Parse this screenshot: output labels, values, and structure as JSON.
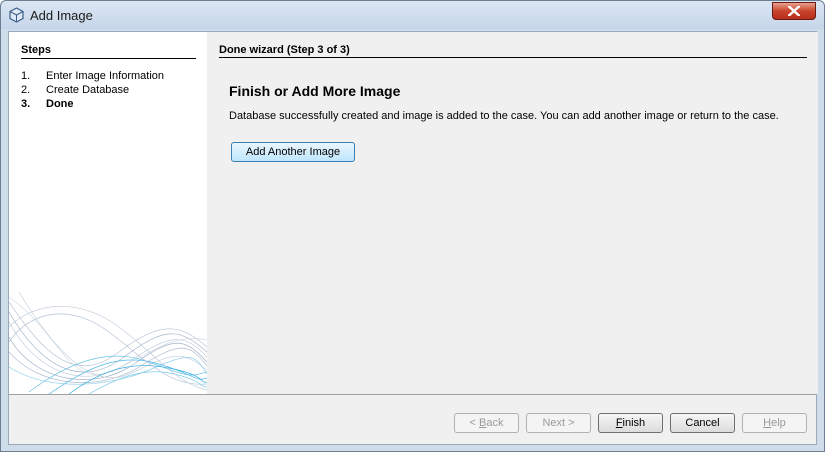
{
  "window": {
    "title": "Add Image"
  },
  "steps": {
    "title": "Steps",
    "items": [
      {
        "num": "1.",
        "label": "Enter Image Information"
      },
      {
        "num": "2.",
        "label": "Create Database"
      },
      {
        "num": "3.",
        "label": "Done"
      }
    ],
    "current_index": 2
  },
  "content": {
    "header": "Done wizard (Step 3 of 3)",
    "heading": "Finish or Add More Image",
    "message": "Database successfully created and image is added to the case. You can add another image or return to the case.",
    "add_button": "Add Another Image"
  },
  "buttons": {
    "back": {
      "prefix": "< ",
      "mnemonic": "B",
      "rest": "ack",
      "enabled": false
    },
    "next": {
      "label": "Next >",
      "enabled": false
    },
    "finish": {
      "prefix": "",
      "mnemonic": "F",
      "rest": "inish",
      "enabled": true
    },
    "cancel": {
      "label": "Cancel",
      "enabled": true
    },
    "help": {
      "prefix": "",
      "mnemonic": "H",
      "rest": "elp",
      "enabled": false
    }
  }
}
